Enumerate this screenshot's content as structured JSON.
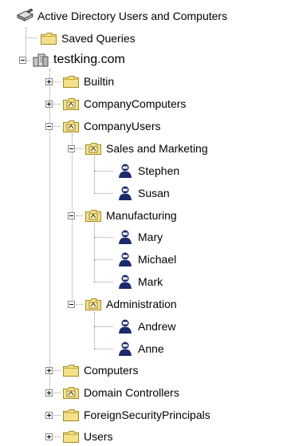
{
  "tree": {
    "root": {
      "label": "Active Directory Users and Computers",
      "icon": "ad-console-icon"
    },
    "saved_queries": {
      "label": "Saved Queries",
      "icon": "folder-icon"
    },
    "domain": {
      "label": "testking.com",
      "icon": "domain-icon",
      "expanded": true
    },
    "builtin": {
      "label": "Builtin",
      "icon": "folder-icon",
      "expanded": false
    },
    "company_computers": {
      "label": "CompanyComputers",
      "icon": "ou-icon",
      "expanded": false
    },
    "company_users": {
      "label": "CompanyUsers",
      "icon": "ou-icon",
      "expanded": true
    },
    "sales": {
      "label": "Sales and Marketing",
      "icon": "ou-icon",
      "expanded": true
    },
    "stephen": {
      "label": "Stephen",
      "icon": "user-icon"
    },
    "susan": {
      "label": "Susan",
      "icon": "user-icon"
    },
    "manufacturing": {
      "label": "Manufacturing",
      "icon": "ou-icon",
      "expanded": true
    },
    "mary": {
      "label": "Mary",
      "icon": "user-icon"
    },
    "michael": {
      "label": "Michael",
      "icon": "user-icon"
    },
    "mark": {
      "label": "Mark",
      "icon": "user-icon"
    },
    "administration": {
      "label": "Administration",
      "icon": "ou-icon",
      "expanded": true
    },
    "andrew": {
      "label": "Andrew",
      "icon": "user-icon"
    },
    "anne": {
      "label": "Anne",
      "icon": "user-icon"
    },
    "computers": {
      "label": "Computers",
      "icon": "folder-icon",
      "expanded": false
    },
    "domain_controllers": {
      "label": "Domain Controllers",
      "icon": "ou-icon",
      "expanded": false
    },
    "foreign_security_principals": {
      "label": "ForeignSecurityPrincipals",
      "icon": "folder-icon",
      "expanded": false
    },
    "users": {
      "label": "Users",
      "icon": "folder-icon",
      "expanded": false
    }
  },
  "colors": {
    "folder": "#f2e08a",
    "folder_border": "#a68a1e",
    "user": "#1a2a6b",
    "connector": "#9a9a9a"
  }
}
